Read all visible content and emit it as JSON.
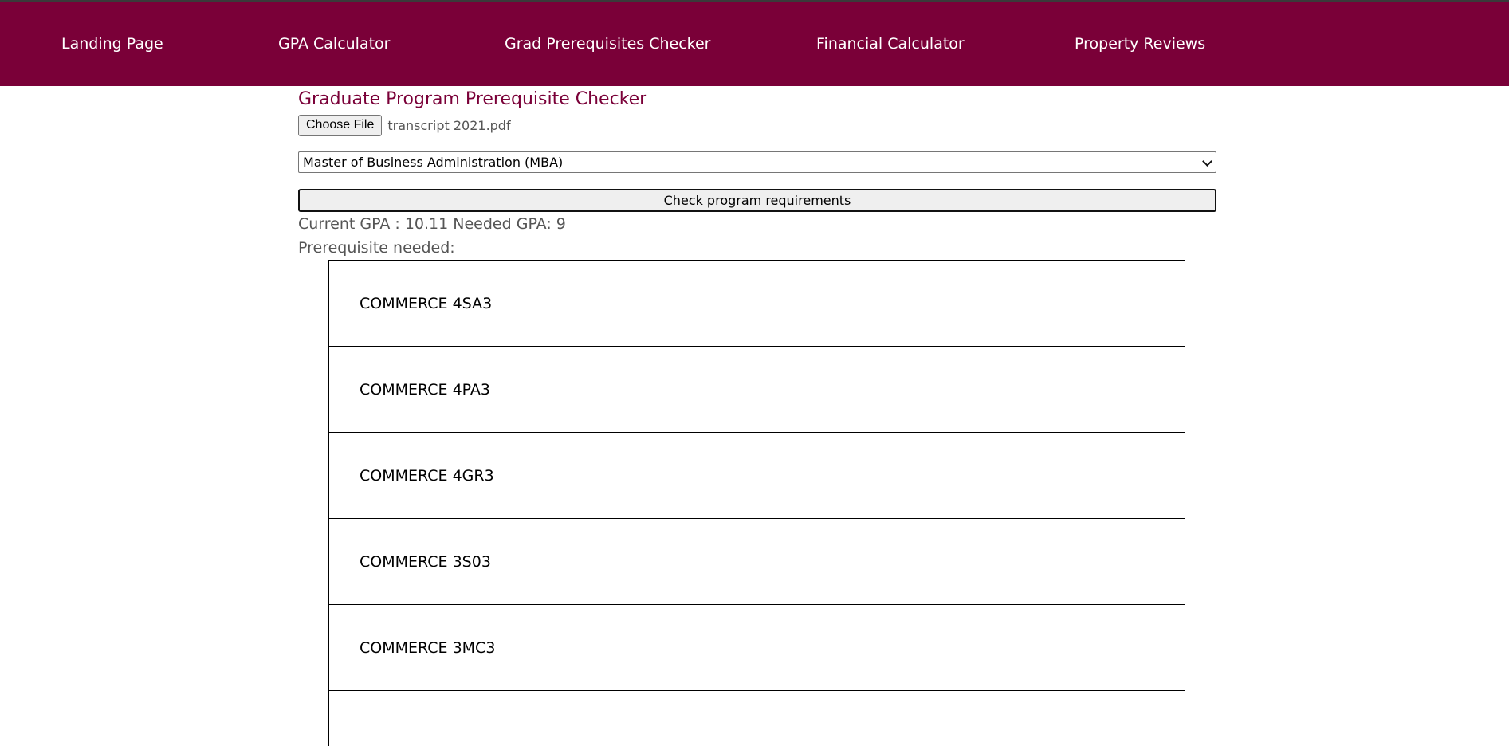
{
  "nav": {
    "items": [
      {
        "label": "Landing Page"
      },
      {
        "label": "GPA Calculator"
      },
      {
        "label": "Grad Prerequisites Checker"
      },
      {
        "label": "Financial Calculator"
      },
      {
        "label": "Property Reviews"
      }
    ]
  },
  "checker": {
    "title": "Graduate Program Prerequisite Checker",
    "choose_file_label": "Choose File",
    "file_name": "transcript 2021.pdf",
    "program_selected": "Master of Business Administration (MBA)",
    "check_button_label": "Check program requirements",
    "gpa_text": "Current GPA : 10.11 Needed GPA: 9",
    "prereq_label": "Prerequisite needed:",
    "prerequisites": [
      "COMMERCE 4SA3",
      "COMMERCE 4PA3",
      "COMMERCE 4GR3",
      "COMMERCE 3S03",
      "COMMERCE 3MC3",
      ""
    ]
  },
  "colors": {
    "brand": "#7a0038",
    "nav_text": "#ffffff",
    "muted_text": "#555555"
  }
}
